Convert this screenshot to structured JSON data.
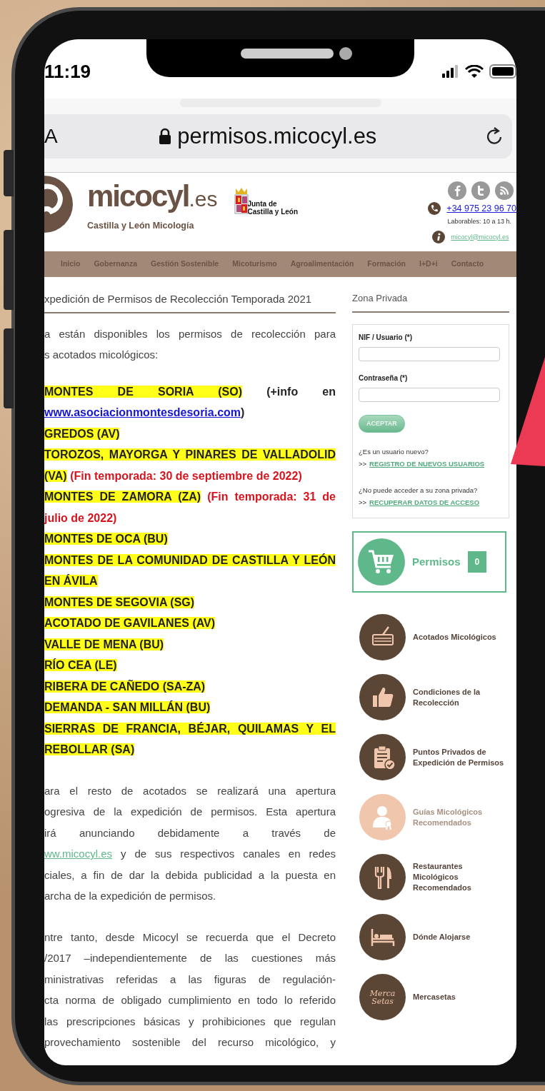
{
  "status_bar": {
    "time": "11:19"
  },
  "address_bar": {
    "text_size_button": "A",
    "url": "permisos.micocyl.es"
  },
  "header": {
    "brand": "micocyl",
    "brand_suffix": ".es",
    "tagline": "Castilla y León Micología",
    "partner_lines": [
      "Junta de",
      "Castilla y León"
    ],
    "phone": "+34 975 23 96 70",
    "hours": "Laborables: 10 a 13 h.",
    "email": "micocyl@micocyl.es"
  },
  "nav": [
    "Inicio",
    "Gobernanza",
    "Gestión Sostenible",
    "Micoturismo",
    "Agroalimentación",
    "Formación",
    "I+D+i",
    "Contacto"
  ],
  "article": {
    "title": "xpedición de Permisos de Recolección Temporada 2021",
    "intro_lines": [
      "a están disponibles los permisos de recolección para",
      "s acotados micológicos:"
    ],
    "areas": [
      {
        "name": "MONTES DE SORIA (SO)",
        "info": {
          "prefix": "(+info en",
          "link": "www.asociacionmontesdesoria.com",
          "suffix": ")"
        }
      },
      {
        "name": "GREDOS (AV)"
      },
      {
        "name": "TOROZOS, MAYORGA Y PINARES DE VALLADOLID (VA)",
        "note": "(Fin temporada: 30 de septiembre de 2022)"
      },
      {
        "name": "MONTES DE ZAMORA (ZA)",
        "note": "(Fin temporada: 31 de julio de 2022)"
      },
      {
        "name": "MONTES DE OCA (BU)"
      },
      {
        "name": "MONTES DE LA COMUNIDAD DE CASTILLA Y LEÓN EN ÁVILA"
      },
      {
        "name": "MONTES DE SEGOVIA (SG)"
      },
      {
        "name": "ACOTADO DE GAVILANES (AV)"
      },
      {
        "name": "VALLE DE MENA (BU)"
      },
      {
        "name": "RÍO CEA (LE)"
      },
      {
        "name": "RIBERA DE CAÑEDO (SA-ZA)"
      },
      {
        "name": "DEMANDA - SAN MILLÁN (BU)"
      },
      {
        "name": "SIERRAS DE FRANCIA, BÉJAR, QUILAMAS Y EL REBOLLAR (SA)"
      }
    ],
    "paragraphs": [
      [
        {
          "text": "ara el resto de acotados se realizará una apertura"
        },
        {
          "text": "ogresiva de la expedición de permisos. Esta apertura"
        },
        {
          "text": "irá anunciando debidamente a través de"
        },
        {
          "link": "ww.micocyl.es",
          "text": "y de sus respectivos canales en redes"
        },
        {
          "text": "ciales, a fin de dar la debida publicidad a la puesta en"
        },
        {
          "text": "archa de la expedición de permisos."
        }
      ],
      [
        {
          "text": "ntre tanto, desde Micocyl se recuerda que el Decreto"
        },
        {
          "text": "/2017 –independientemente de las cuestiones más"
        },
        {
          "text": "ministrativas referidas a las figuras de regulación-"
        },
        {
          "text": "cta norma de obligado cumplimiento en todo lo referido"
        },
        {
          "text": "las prescripciones básicas y prohibiciones que regulan"
        },
        {
          "text": "provechamiento sostenible del recurso micológico, y"
        }
      ]
    ]
  },
  "sidebar": {
    "title": "Zona Privada",
    "login": {
      "fields": [
        {
          "label": "NIF / Usuario (*)"
        },
        {
          "label": "Contraseña (*)"
        }
      ],
      "submit": "ACEPTAR",
      "links": [
        {
          "question": "¿Es un usuario nuevo?",
          "prefix": ">>",
          "link": "REGISTRO DE NUEVOS USUARIOS"
        },
        {
          "question": "¿No puede acceder a su zona privada?",
          "prefix": ">>",
          "link": "RECUPERAR DATOS DE ACCESO"
        }
      ]
    },
    "cart": {
      "label": "Permisos",
      "count": "0"
    },
    "menu": [
      {
        "label": "Acotados Micológicos",
        "kind": "basket",
        "dimmed": false
      },
      {
        "label": "Condiciones de la Recolección",
        "kind": "thumb",
        "dimmed": false
      },
      {
        "label": "Puntos Privados de Expedición de Permisos",
        "kind": "clipboard",
        "dimmed": false
      },
      {
        "label": "Guías Micológicos Recomendados",
        "kind": "guide",
        "dimmed": true
      },
      {
        "label": "Restaurantes Micológicos Recomendados",
        "kind": "cutlery",
        "dimmed": false
      },
      {
        "label": "Dónde Alojarse",
        "kind": "bed",
        "dimmed": false
      },
      {
        "label": "Mercasetas",
        "kind": "logo",
        "logo_lines": [
          "Merca",
          "Setas"
        ],
        "dimmed": false
      }
    ]
  }
}
